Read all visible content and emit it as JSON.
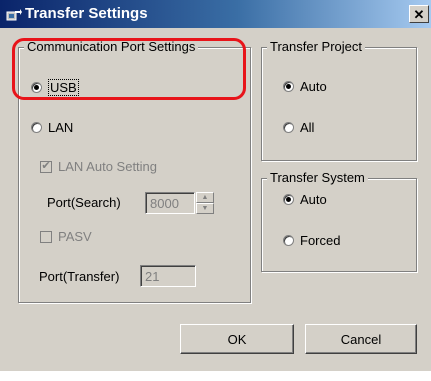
{
  "window": {
    "title": "Transfer Settings",
    "close_label": "✕"
  },
  "communication": {
    "legend": "Communication Port Settings",
    "usb_label": "USB",
    "lan_label": "LAN",
    "lan_auto_setting_label": "LAN Auto Setting",
    "lan_auto_setting_checked": true,
    "port_search_label": "Port(Search)",
    "port_search_value": "8000",
    "pasv_label": "PASV",
    "pasv_checked": false,
    "port_transfer_label": "Port(Transfer)",
    "port_transfer_value": "21",
    "selected": "USB"
  },
  "transfer_project": {
    "legend": "Transfer Project",
    "auto_label": "Auto",
    "all_label": "All",
    "selected": "Auto"
  },
  "transfer_system": {
    "legend": "Transfer System",
    "auto_label": "Auto",
    "forced_label": "Forced",
    "selected": "Auto"
  },
  "buttons": {
    "ok_label": "OK",
    "cancel_label": "Cancel"
  },
  "colors": {
    "highlight": "#e8141a",
    "title_bar": "#0a246a",
    "dialog_bg": "#d4d0c8"
  },
  "icons": {
    "title": "transfer-icon",
    "close": "close-icon"
  }
}
